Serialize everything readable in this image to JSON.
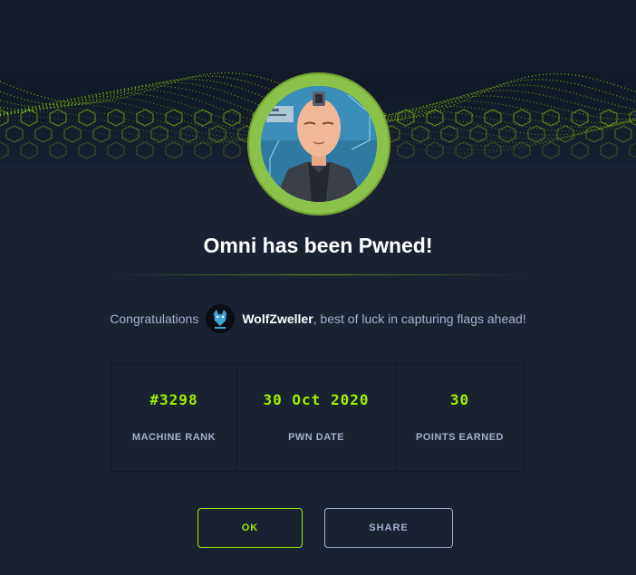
{
  "title": "Omni has been Pwned!",
  "congrats": {
    "prefix": "Congratulations",
    "username": "WolfZweller",
    "suffix": ", best of luck in capturing flags ahead!"
  },
  "stats": [
    {
      "value": "#3298",
      "label": "MACHINE RANK"
    },
    {
      "value": "30 Oct 2020",
      "label": "PWN DATE"
    },
    {
      "value": "30",
      "label": "POINTS EARNED"
    }
  ],
  "buttons": {
    "ok": "OK",
    "share": "SHARE"
  },
  "colors": {
    "accent": "#9fef00",
    "background": "#1a2232",
    "muted": "#a4b1cd"
  },
  "images": {
    "banner": "green-hex-wave-banner",
    "machine_avatar": "omni-android-avatar",
    "user_avatar": "wolf-avatar"
  }
}
